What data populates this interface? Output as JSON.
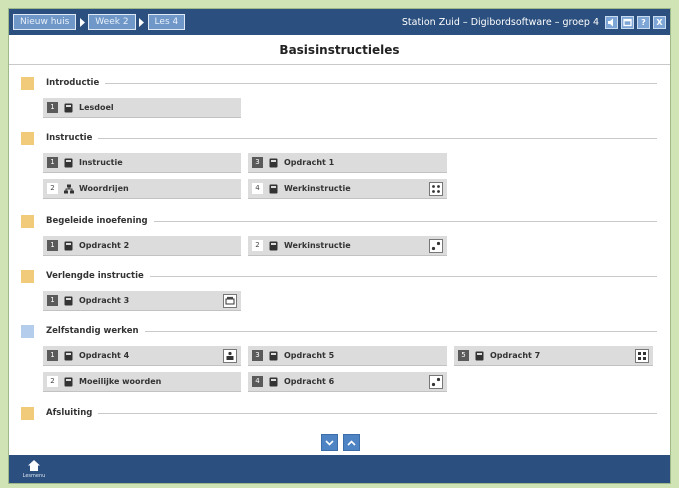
{
  "breadcrumb": [
    {
      "label": "Nieuw huis"
    },
    {
      "label": "Week 2"
    },
    {
      "label": "Les 4"
    }
  ],
  "app_title": "Station Zuid – Digibordsoftware – groep 4",
  "window_buttons": [
    "sound-icon",
    "window-icon",
    "help-icon",
    "close-icon"
  ],
  "window_button_text": {
    "help": "?",
    "close": "X"
  },
  "page_title": "Basisinstructieles",
  "sections": [
    {
      "title": "Introductie",
      "color": "#f1cb79",
      "tiles": [
        {
          "num": "1",
          "label": "Lesdoel"
        }
      ]
    },
    {
      "title": "Instructie",
      "color": "#f1cb79",
      "tiles": [
        {
          "num": "1",
          "label": "Instructie"
        },
        {
          "num": "3",
          "label": "Opdracht 1"
        },
        {
          "num": "2",
          "label": "Woordrijen"
        },
        {
          "num": "4",
          "label": "Werkinstructie"
        }
      ]
    },
    {
      "title": "Begeleide inoefening",
      "color": "#f1cb79",
      "tiles": [
        {
          "num": "1",
          "label": "Opdracht 2"
        },
        {
          "num": "2",
          "label": "Werkinstructie"
        }
      ]
    },
    {
      "title": "Verlengde instructie",
      "color": "#f1cb79",
      "tiles": [
        {
          "num": "1",
          "label": "Opdracht 3"
        }
      ]
    },
    {
      "title": "Zelfstandig werken",
      "color": "#b4cdec",
      "tiles": [
        {
          "num": "1",
          "label": "Opdracht 4"
        },
        {
          "num": "3",
          "label": "Opdracht 5"
        },
        {
          "num": "5",
          "label": "Opdracht 7"
        },
        {
          "num": "2",
          "label": "Moeilijke woorden"
        },
        {
          "num": "4",
          "label": "Opdracht 6"
        }
      ]
    },
    {
      "title": "Afsluiting",
      "color": "#f1cb79",
      "tiles": []
    }
  ],
  "home": {
    "label": "Lesmenu"
  }
}
